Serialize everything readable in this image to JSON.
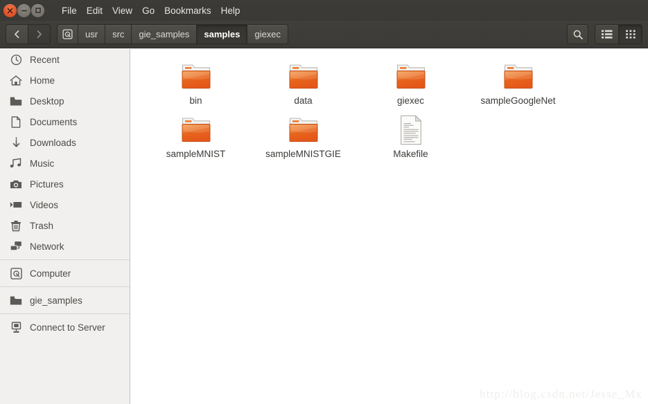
{
  "window": {
    "controls": [
      {
        "name": "close",
        "glyph": "×"
      },
      {
        "name": "minimize",
        "glyph": "−"
      },
      {
        "name": "maximize",
        "glyph": "□"
      }
    ],
    "menu": [
      "File",
      "Edit",
      "View",
      "Go",
      "Bookmarks",
      "Help"
    ]
  },
  "toolbar": {
    "back_icon": "chevron-left-icon",
    "forward_icon": "chevron-right-icon",
    "breadcrumbs": [
      {
        "label": "",
        "icon": "computer-icon",
        "active": false
      },
      {
        "label": "usr",
        "active": false
      },
      {
        "label": "src",
        "active": false
      },
      {
        "label": "gie_samples",
        "active": false
      },
      {
        "label": "samples",
        "active": true
      },
      {
        "label": "giexec",
        "active": false
      }
    ],
    "search_icon": "search-icon",
    "view_list_icon": "list-view-icon",
    "view_grid_icon": "grid-view-icon",
    "view_selected": "grid"
  },
  "sidebar": {
    "groups": [
      {
        "items": [
          {
            "label": "Recent",
            "icon": "clock-icon"
          },
          {
            "label": "Home",
            "icon": "home-icon"
          },
          {
            "label": "Desktop",
            "icon": "folder-icon"
          },
          {
            "label": "Documents",
            "icon": "document-icon"
          },
          {
            "label": "Downloads",
            "icon": "download-icon"
          },
          {
            "label": "Music",
            "icon": "music-note-icon"
          },
          {
            "label": "Pictures",
            "icon": "camera-icon"
          },
          {
            "label": "Videos",
            "icon": "film-icon"
          },
          {
            "label": "Trash",
            "icon": "trash-icon"
          },
          {
            "label": "Network",
            "icon": "network-icon"
          }
        ]
      },
      {
        "items": [
          {
            "label": "Computer",
            "icon": "computer-icon"
          }
        ]
      },
      {
        "items": [
          {
            "label": "gie_samples",
            "icon": "folder-icon"
          }
        ]
      },
      {
        "items": [
          {
            "label": "Connect to Server",
            "icon": "server-icon"
          }
        ]
      }
    ]
  },
  "content": {
    "items": [
      {
        "label": "bin",
        "type": "folder"
      },
      {
        "label": "data",
        "type": "folder"
      },
      {
        "label": "giexec",
        "type": "folder"
      },
      {
        "label": "sampleGoogleNet",
        "type": "folder"
      },
      {
        "label": "sampleMNIST",
        "type": "folder"
      },
      {
        "label": "sampleMNISTGIE",
        "type": "folder"
      },
      {
        "label": "Makefile",
        "type": "file"
      }
    ]
  },
  "watermark": {
    "text": "http://blog.csdn.net/Jesse_Mx"
  },
  "colors": {
    "titlebar": "#3b3a36",
    "toolbar": "#3e3d39",
    "sidebar": "#f1f0ee",
    "content": "#ffffff",
    "folder_orange": "#e8621d",
    "close_button": "#df542a",
    "text_light": "#e6e4e0",
    "text_dark": "#4c4b48"
  }
}
